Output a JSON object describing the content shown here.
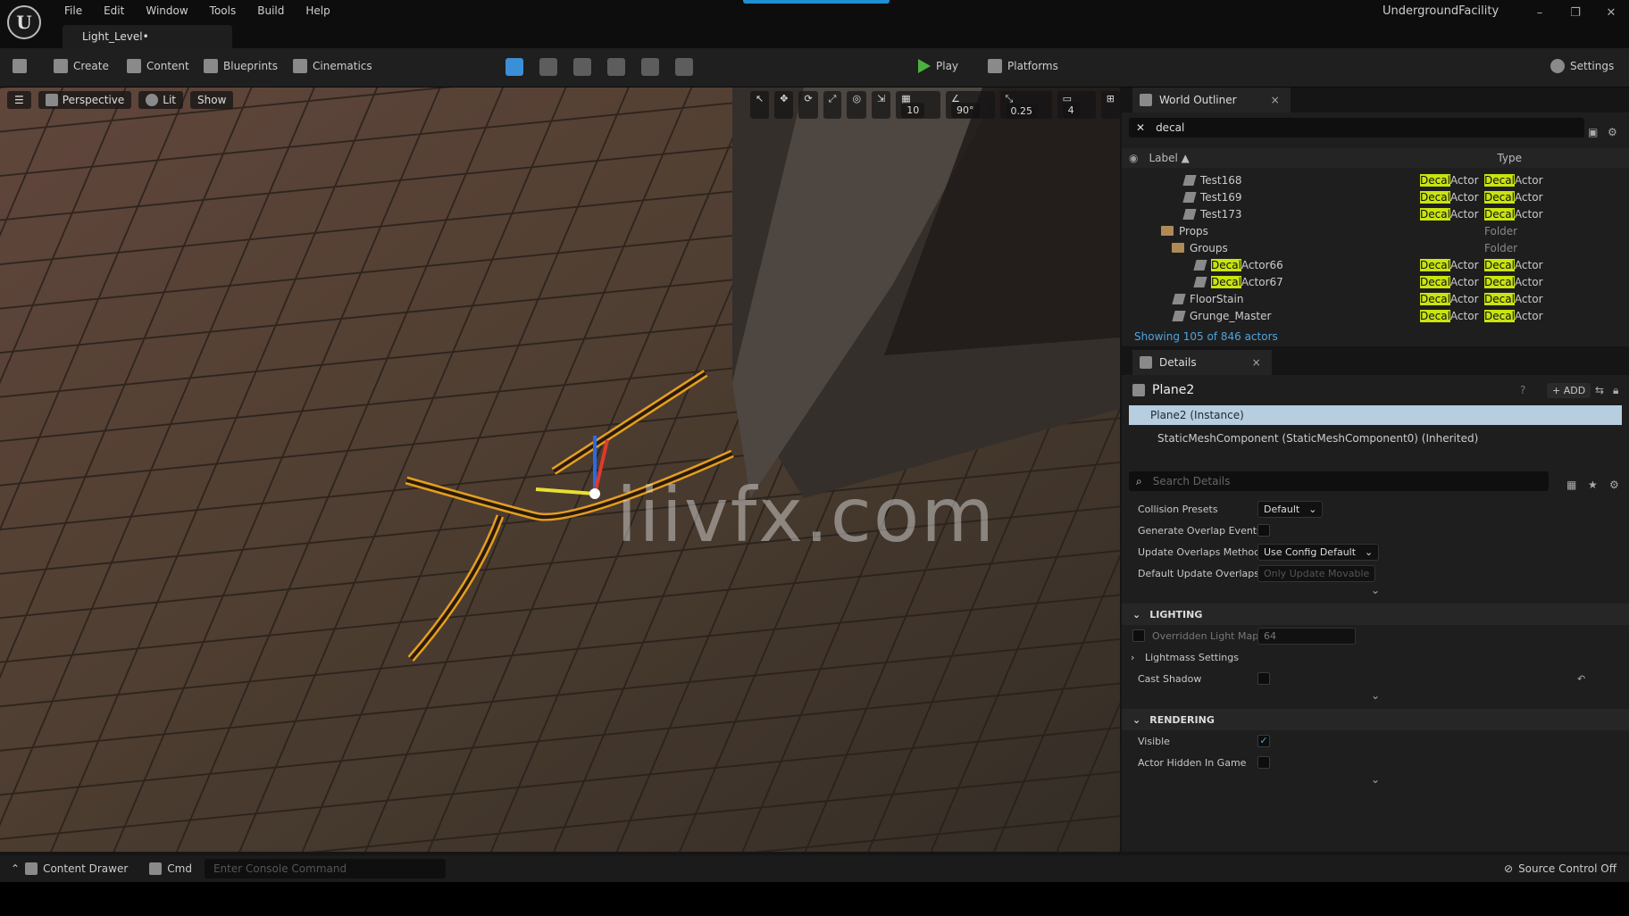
{
  "app": {
    "logo": "U",
    "project": "UndergroundFacility",
    "tab": "Light_Level•"
  },
  "menu": [
    "File",
    "Edit",
    "Window",
    "Tools",
    "Build",
    "Help"
  ],
  "window_controls": [
    "–",
    "❐",
    "✕"
  ],
  "toolbar": {
    "create": "Create",
    "content": "Content",
    "blueprints": "Blueprints",
    "cinematics": "Cinematics",
    "play": "Play",
    "platforms": "Platforms",
    "settings": "Settings"
  },
  "viewport": {
    "perspective": "Perspective",
    "lit": "Lit",
    "show": "Show",
    "grid": "10",
    "angle": "90°",
    "scale": "0.25",
    "camera": "4",
    "watermark": "iiivfx.com"
  },
  "outliner": {
    "title": "World Outliner",
    "search": "decal",
    "col_label": "Label ▲",
    "col_type": "Type",
    "rows": [
      {
        "pre": "",
        "hl": "",
        "name": "Test168",
        "t1hl": "Decal",
        "t1": "Actor",
        "t2hl": "Decal",
        "t2": "Actor",
        "indent": 70,
        "kind": "actor"
      },
      {
        "pre": "",
        "hl": "",
        "name": "Test169",
        "t1hl": "Decal",
        "t1": "Actor",
        "t2hl": "Decal",
        "t2": "Actor",
        "indent": 70,
        "kind": "actor"
      },
      {
        "pre": "",
        "hl": "",
        "name": "Test173",
        "t1hl": "Decal",
        "t1": "Actor",
        "t2hl": "Decal",
        "t2": "Actor",
        "indent": 70,
        "kind": "actor"
      },
      {
        "pre": "",
        "hl": "",
        "name": "Props",
        "t1hl": "",
        "t1": "",
        "t2hl": "",
        "t2": "Folder",
        "indent": 44,
        "kind": "folder"
      },
      {
        "pre": "",
        "hl": "",
        "name": "Groups",
        "t1hl": "",
        "t1": "",
        "t2hl": "",
        "t2": "Folder",
        "indent": 56,
        "kind": "folder"
      },
      {
        "pre": "",
        "hl": "Decal",
        "name": "Actor66",
        "t1hl": "Decal",
        "t1": "Actor",
        "t2hl": "Decal",
        "t2": "Actor",
        "indent": 82,
        "kind": "actor"
      },
      {
        "pre": "",
        "hl": "Decal",
        "name": "Actor67",
        "t1hl": "Decal",
        "t1": "Actor",
        "t2hl": "Decal",
        "t2": "Actor",
        "indent": 82,
        "kind": "actor"
      },
      {
        "pre": "",
        "hl": "",
        "name": "FloorStain",
        "t1hl": "Decal",
        "t1": "Actor",
        "t2hl": "Decal",
        "t2": "Actor",
        "indent": 58,
        "kind": "actor"
      },
      {
        "pre": "",
        "hl": "",
        "name": "Grunge_Master",
        "t1hl": "Decal",
        "t1": "Actor",
        "t2hl": "Decal",
        "t2": "Actor",
        "indent": 58,
        "kind": "actor"
      }
    ],
    "count": "Showing 105 of 846 actors"
  },
  "details": {
    "title": "Details",
    "object": "Plane2",
    "add": "ADD",
    "instance": "Plane2 (Instance)",
    "component": "StaticMeshComponent (StaticMeshComponent0) (Inherited)",
    "search_placeholder": "Search Details",
    "collision_presets": "Collision Presets",
    "collision_value": "Default",
    "gen_overlap": "Generate Overlap Events",
    "upd_overlap": "Update Overlaps Method",
    "upd_value": "Use Config Default",
    "def_upd": "Default Update Overlaps I",
    "def_upd_value": "Only Update Movable",
    "lighting": "LIGHTING",
    "override_lm": "Overridden Light Map",
    "lm_value": "64",
    "lightmass": "Lightmass Settings",
    "cast_shadow": "Cast Shadow",
    "rendering": "RENDERING",
    "visible": "Visible",
    "hidden_game": "Actor Hidden In Game"
  },
  "status": {
    "content_drawer": "Content Drawer",
    "cmd": "Cmd",
    "console_placeholder": "Enter Console Command",
    "source_control": "Source Control Off"
  }
}
